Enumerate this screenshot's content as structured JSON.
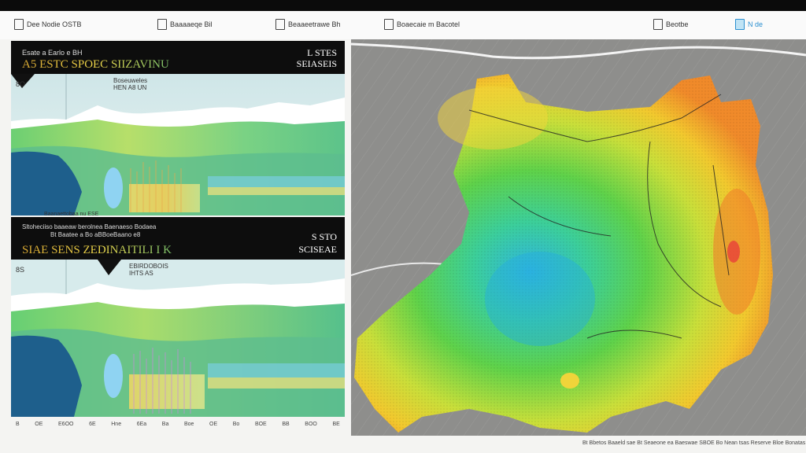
{
  "toolbar": {
    "items": [
      {
        "label": "Dee Nodie OSTB",
        "icon": "document-icon"
      },
      {
        "label": "Baaaaeqe Bil",
        "icon": "document-icon"
      },
      {
        "label": "Beaaeetrawe Bh",
        "icon": "document-icon"
      },
      {
        "label": "Boaecaie m Bacotel",
        "icon": "document-icon"
      },
      {
        "label": "Beotbe",
        "icon": "tools-icon"
      },
      {
        "label": "N de",
        "icon": "image-icon"
      }
    ]
  },
  "panel_top": {
    "header_line1": "Esate a Earlo e BH",
    "header_title": "A5 ESTC SPOEC SIIZAVINU",
    "header_badge_top": "L STES",
    "header_badge_bottom": "SEIASEIS",
    "subtitle": "Boseuweles\nHEN A8 UN",
    "corner_label": "8O",
    "bottom_caption": "Baanaettobaa nu ESE"
  },
  "panel_bottom": {
    "header_line1": "Sltoheciiso baaeaw berolnea Baenaeso Bodaea",
    "header_line2": "Bt Baatee a Bo aBBoeBaano e8",
    "header_title": "SIAE SENS ZEDINAITILI I K",
    "header_badge_top": "S STO",
    "header_badge_bottom": "SCISEAE",
    "subtitle": "EBIRDOBOIS\nIHTS AS",
    "corner_label": "8S"
  },
  "footer": {
    "ticks": [
      "B",
      "OE",
      "E6OO",
      "6E",
      "Hne",
      "6Ea",
      "Ba",
      "Boe",
      "OE",
      "Bo",
      "BOE",
      "BB",
      "BOO",
      "BE"
    ]
  },
  "status_bar": "Bt Bbetos Baaeld sae Bt Seaeone ea Baeswae SBOE Bo Nean tsas Reserve Bloe Bonatas"
}
